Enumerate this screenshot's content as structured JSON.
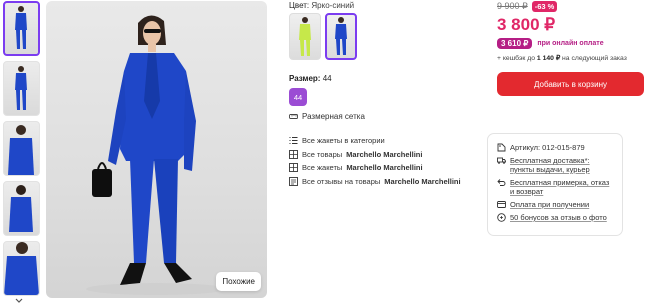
{
  "gallery": {
    "thumbnails": [
      {
        "alt": "full-length front"
      },
      {
        "alt": "full-length side"
      },
      {
        "alt": "jacket front"
      },
      {
        "alt": "jacket back"
      },
      {
        "alt": "jacket detail"
      }
    ],
    "similar_label": "Похожие"
  },
  "product": {
    "color_label": "Цвет:",
    "color_value": "Ярко-синий",
    "swatches": [
      {
        "color": "#c6e84a"
      },
      {
        "color": "#1f47c8"
      }
    ],
    "size_label": "Размер:",
    "size_value": "44",
    "size_chip": "44",
    "size_grid_label": "Размерная сетка",
    "links": [
      {
        "icon": "list-icon",
        "prefix": "Все жакеты в категории",
        "bold": ""
      },
      {
        "icon": "grid-icon",
        "prefix": "Все товары ",
        "bold": "Marchello Marchellini"
      },
      {
        "icon": "grid-icon",
        "prefix": "Все жакеты ",
        "bold": "Marchello Marchellini"
      },
      {
        "icon": "reviews-icon",
        "prefix": "Все отзывы на товары ",
        "bold": "Marchello Marchellini"
      }
    ]
  },
  "pricing": {
    "old_price": "9 900 ₽",
    "discount": "-63 %",
    "price": "3 800 ₽",
    "online_price": "3 610 ₽",
    "online_text": "при онлайн оплате",
    "cashback_prefix": "+ кешбэк до ",
    "cashback_amount": "1 140 ₽",
    "cashback_suffix": " на следующий заказ",
    "cart_button": "Добавить в корзину"
  },
  "details": [
    {
      "icon": "article-icon",
      "text": "Артикул: 012-015-879",
      "link": false
    },
    {
      "icon": "truck-icon",
      "text": "Бесплатная доставка*: пункты выдачи, курьер",
      "link": true
    },
    {
      "icon": "return-icon",
      "text": "Бесплатная примерка, отказ и возврат",
      "link": true
    },
    {
      "icon": "card-icon",
      "text": "Оплата при получении",
      "link": true
    },
    {
      "icon": "bonus-icon",
      "text": "50 бонусов за отзыв о фото",
      "link": true
    }
  ],
  "colors": {
    "accent": "#7b3cf0",
    "price": "#e02767",
    "online": "#b51e85",
    "cart": "#e3292f",
    "suit": "#1f47c8",
    "size_chip": "#9b4cd4"
  }
}
